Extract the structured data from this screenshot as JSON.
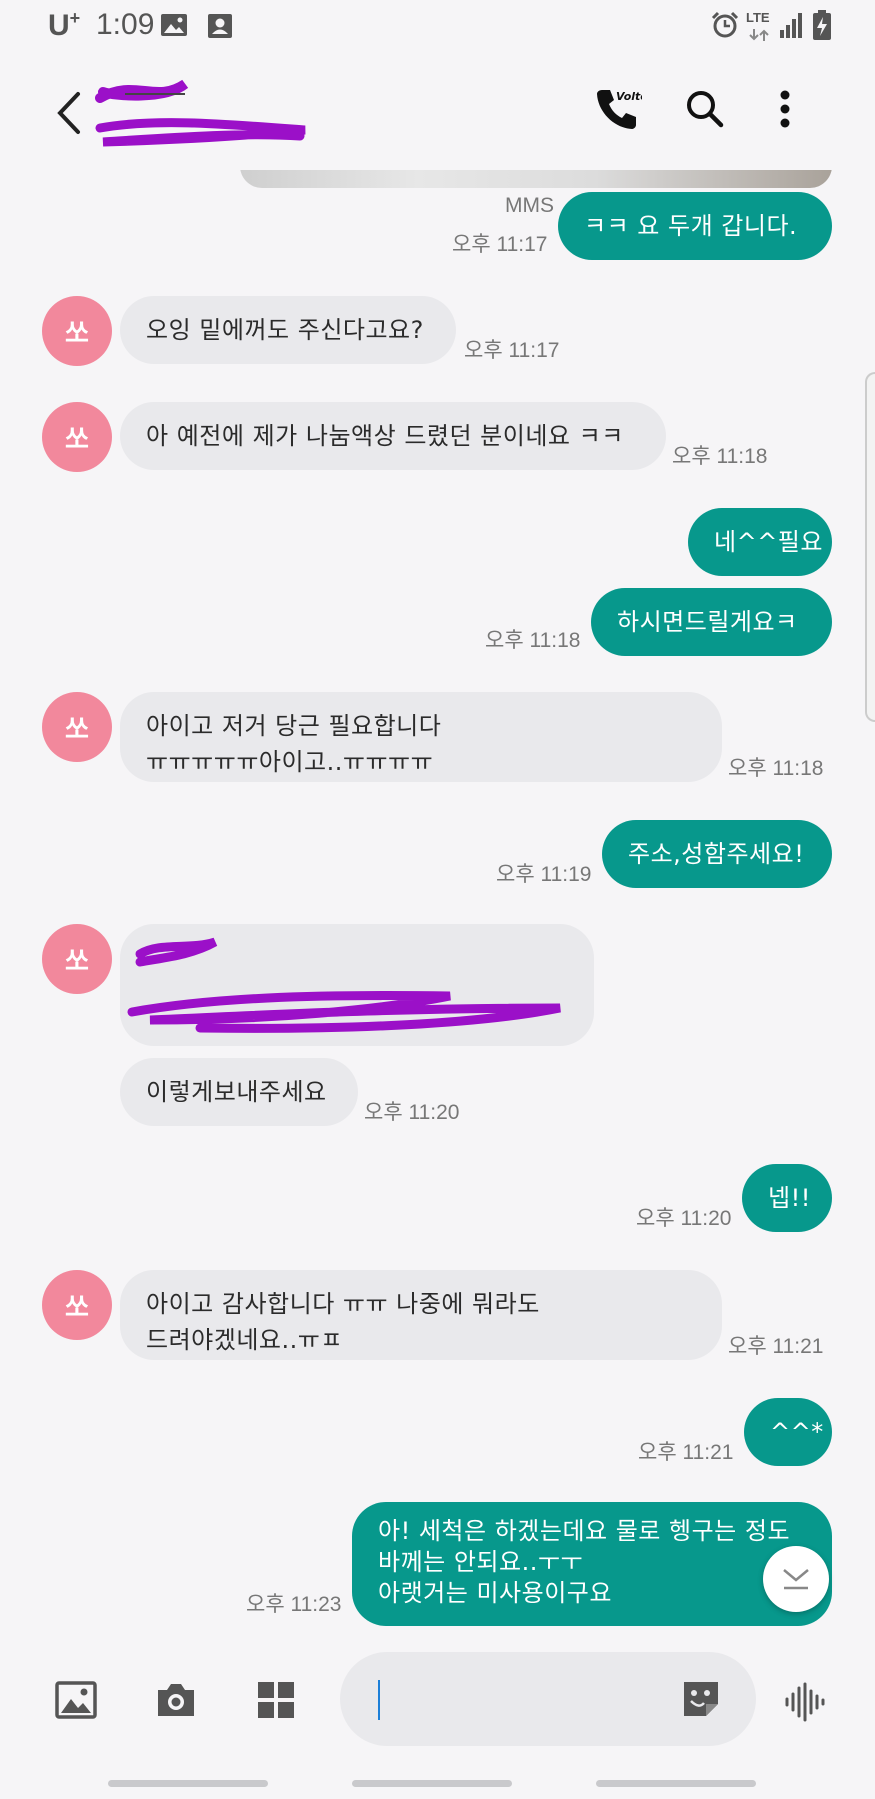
{
  "status_bar": {
    "carrier": "U",
    "carrier_plus": "+",
    "time": "1:09",
    "network": "LTE"
  },
  "header": {
    "back_icon": "back-arrow-icon",
    "call_icon": "volte-call-icon",
    "volte_label": "Volte",
    "search_icon": "search-icon",
    "menu_icon": "more-vert-icon"
  },
  "conversation": {
    "avatar_label": "쏘",
    "messages": [
      {
        "dir": "out",
        "text": "ㅋㅋ 요 두개 갑니다.",
        "type_label": "MMS",
        "time": "오후 11:17"
      },
      {
        "dir": "in",
        "text": "오잉 밑에꺼도 주신다고요?",
        "time": "오후 11:17"
      },
      {
        "dir": "in",
        "text": "아 예전에 제가 나눔액상 드렸던 분이네요 ㅋㅋ",
        "time": "오후 11:18"
      },
      {
        "dir": "out",
        "text": "네^^필요",
        "time": ""
      },
      {
        "dir": "out",
        "text": "하시면드릴게요ㅋ",
        "time": "오후 11:18"
      },
      {
        "dir": "in",
        "text": "아이고 저거 당근 필요합니다\nㅠㅠㅠㅠㅠ아이고..ㅠㅠㅠㅠ",
        "time": "오후 11:18"
      },
      {
        "dir": "out",
        "text": "주소,성함주세요!",
        "time": "오후 11:19"
      },
      {
        "dir": "in",
        "text": "",
        "redacted": true,
        "time": ""
      },
      {
        "dir": "in",
        "text": "이렇게보내주세요",
        "time": "오후 11:20"
      },
      {
        "dir": "out",
        "text": "넵!!",
        "time": "오후 11:20"
      },
      {
        "dir": "in",
        "text": "아이고 감사합니다 ㅠㅠ 나중에 뭐라도\n드려야겠네요..ㅠㅍ",
        "time": "오후 11:21"
      },
      {
        "dir": "out",
        "text": "^^*",
        "time": "오후 11:21"
      },
      {
        "dir": "out",
        "text": "아! 세척은 하겠는데요 물로 헹구는 정도\n바께는 안되요..ㅜㅜ\n아랫거는 미사용이구요",
        "time": "오후 11:23"
      }
    ]
  },
  "composer": {
    "gallery_icon": "gallery-icon",
    "camera_icon": "camera-icon",
    "apps_icon": "apps-grid-icon",
    "input_value": "",
    "input_placeholder": "",
    "sticker_icon": "sticker-icon",
    "voice_icon": "voice-record-icon"
  },
  "colors": {
    "outgoing_bubble": "#07988c",
    "incoming_bubble": "#e9e9ec",
    "avatar": "#f2889c",
    "redaction": "#9b10c8"
  }
}
